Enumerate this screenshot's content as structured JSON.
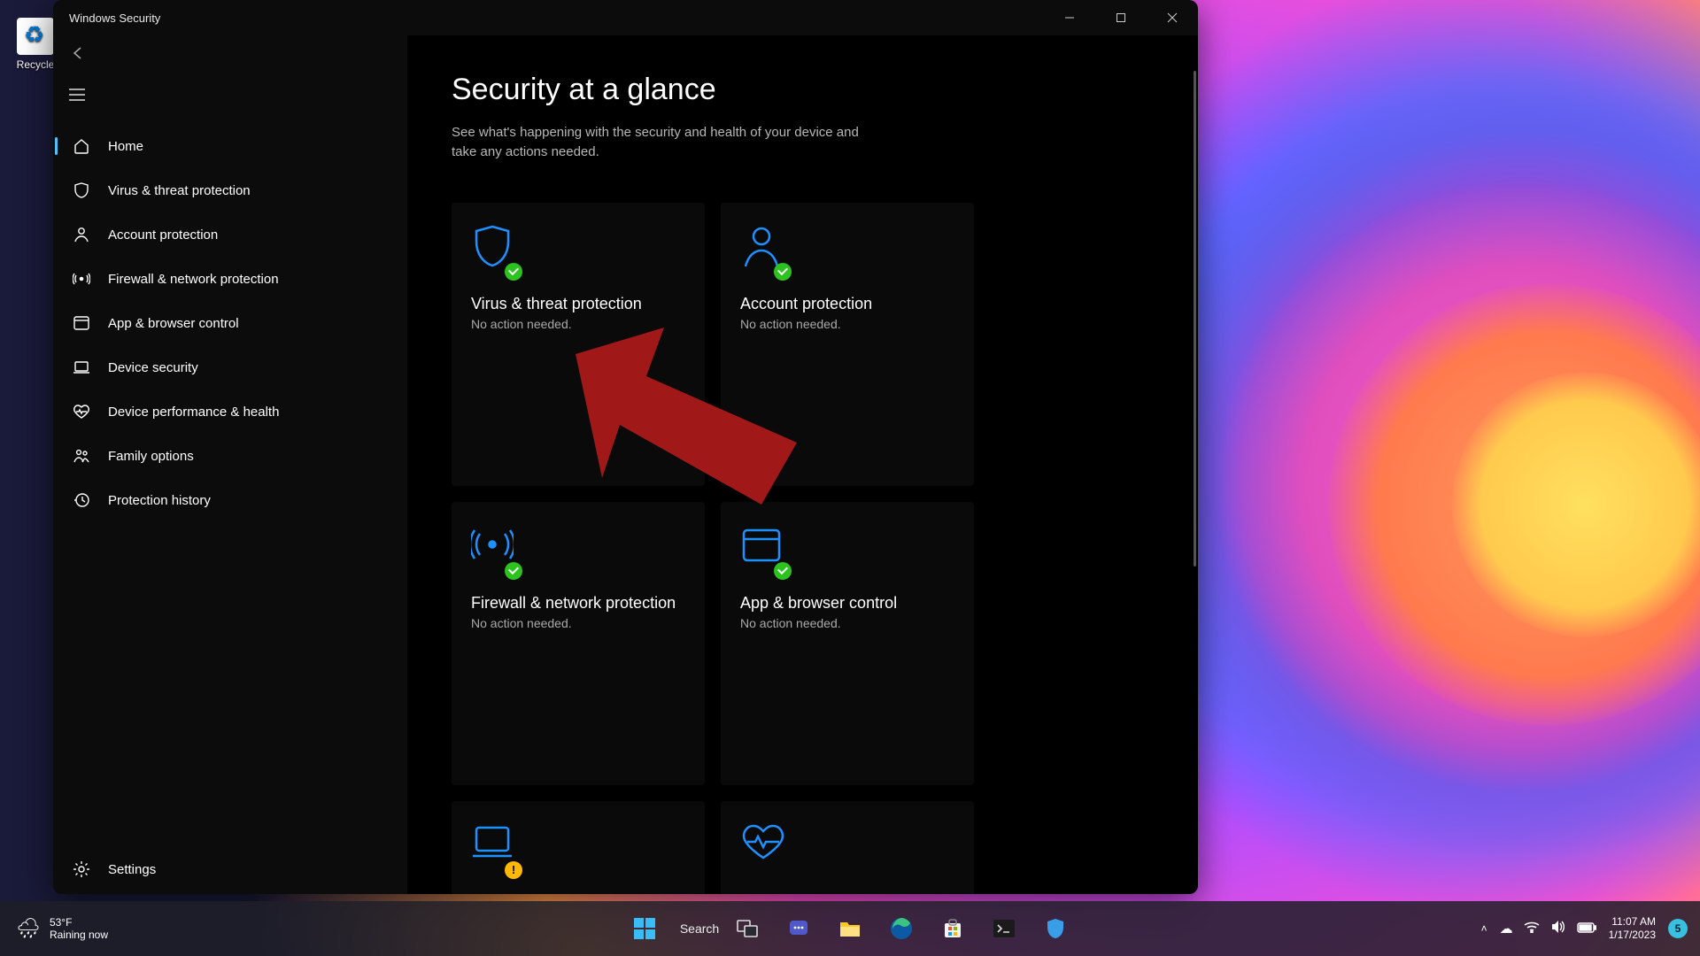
{
  "desktop": {
    "recycle_bin": "Recycle"
  },
  "window": {
    "title": "Windows Security",
    "sidebar": {
      "items": [
        {
          "label": "Home"
        },
        {
          "label": "Virus & threat protection"
        },
        {
          "label": "Account protection"
        },
        {
          "label": "Firewall & network protection"
        },
        {
          "label": "App & browser control"
        },
        {
          "label": "Device security"
        },
        {
          "label": "Device performance & health"
        },
        {
          "label": "Family options"
        },
        {
          "label": "Protection history"
        }
      ],
      "settings": "Settings"
    },
    "main": {
      "heading": "Security at a glance",
      "subheading": "See what's happening with the security and health of your device and take any actions needed.",
      "cards": [
        {
          "title": "Virus & threat protection",
          "status": "No action needed."
        },
        {
          "title": "Account protection",
          "status": "No action needed."
        },
        {
          "title": "Firewall & network protection",
          "status": "No action needed."
        },
        {
          "title": "App & browser control",
          "status": "No action needed."
        }
      ]
    }
  },
  "taskbar": {
    "weather": {
      "temp": "53°F",
      "text": "Raining now"
    },
    "search": "Search",
    "time": "11:07 AM",
    "date": "1/17/2023",
    "notif_count": "5"
  },
  "colors": {
    "accent": "#4cc2ff",
    "icon_blue": "#0078d4",
    "ok": "#2cc31f",
    "warn": "#ffb900",
    "arrow": "#a01818"
  }
}
